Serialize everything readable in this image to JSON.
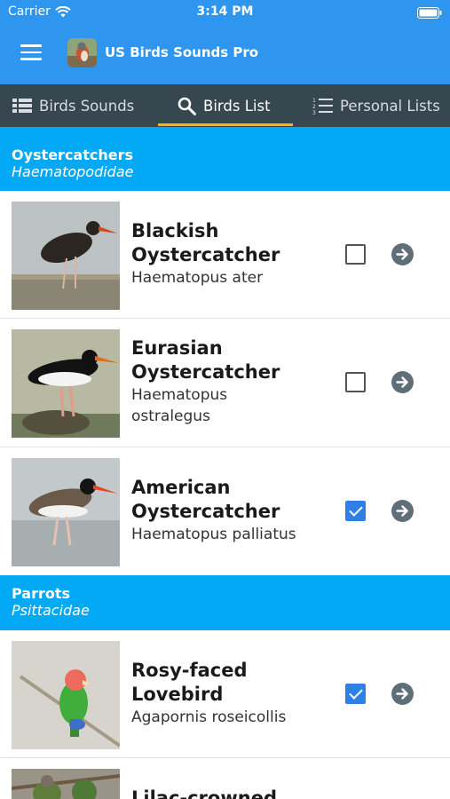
{
  "status_bar": {
    "carrier": "Carrier",
    "time": "3:14 PM"
  },
  "app_bar": {
    "title": "US Birds Sounds Pro"
  },
  "tabs": [
    {
      "label": "Birds Sounds",
      "icon": "list-icon",
      "active": false
    },
    {
      "label": "Birds List",
      "icon": "search-icon",
      "active": true
    },
    {
      "label": "Personal Lists",
      "icon": "numbered-list-icon",
      "active": false
    }
  ],
  "sections": [
    {
      "family": "Oystercatchers",
      "scientific": "Haematopodidae",
      "birds": [
        {
          "common_line1": "Blackish",
          "common_line2": "Oystercatcher",
          "latin_line1": "Haematopus ater",
          "latin_line2": "",
          "checked": false
        },
        {
          "common_line1": "Eurasian",
          "common_line2": "Oystercatcher",
          "latin_line1": "Haematopus",
          "latin_line2": "ostralegus",
          "checked": false
        },
        {
          "common_line1": "American",
          "common_line2": "Oystercatcher",
          "latin_line1": "Haematopus palliatus",
          "latin_line2": "",
          "checked": true
        }
      ]
    },
    {
      "family": "Parrots",
      "scientific": "Psittacidae",
      "birds": [
        {
          "common_line1": "Rosy-faced",
          "common_line2": "Lovebird",
          "latin_line1": "Agapornis roseicollis",
          "latin_line2": "",
          "checked": true
        },
        {
          "common_line1": "Lilac-crowned",
          "common_line2": "",
          "latin_line1": "",
          "latin_line2": "",
          "checked": false
        }
      ]
    }
  ],
  "colors": {
    "app_bar": "#2e96ee",
    "tab_bar": "#37474f",
    "tab_indicator": "#ffb300",
    "section_header": "#03a9f4",
    "checkbox_checked": "#2f80e6",
    "go_button": "#5f6f77"
  }
}
